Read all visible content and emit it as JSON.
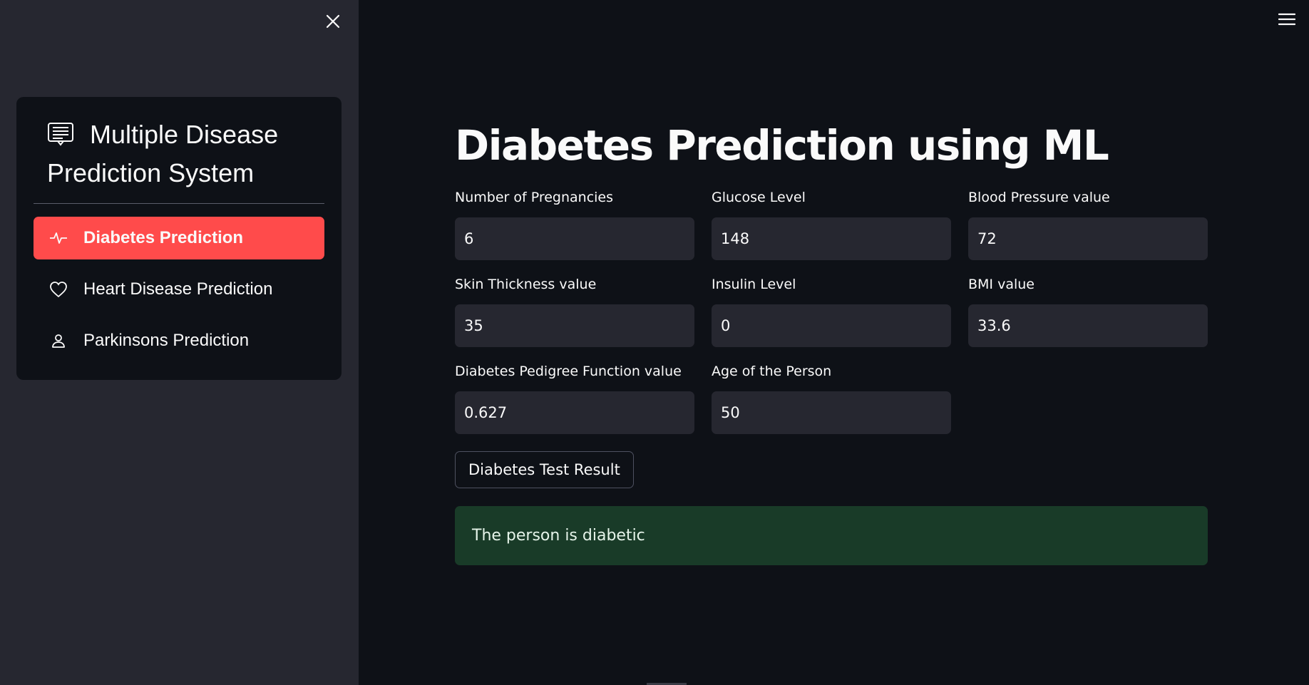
{
  "sidebar": {
    "close_icon": "close-icon",
    "menu": {
      "title": "Multiple Disease Prediction System",
      "title_icon": "document-icon",
      "items": [
        {
          "label": "Diabetes Prediction",
          "icon": "activity-icon",
          "active": true
        },
        {
          "label": "Heart Disease Prediction",
          "icon": "heart-icon",
          "active": false
        },
        {
          "label": "Parkinsons Prediction",
          "icon": "person-icon",
          "active": false
        }
      ]
    }
  },
  "header": {
    "menu_icon": "hamburger-icon"
  },
  "main": {
    "title": "Diabetes Prediction using ML",
    "fields": [
      {
        "label": "Number of Pregnancies",
        "value": "6"
      },
      {
        "label": "Glucose Level",
        "value": "148"
      },
      {
        "label": "Blood Pressure value",
        "value": "72"
      },
      {
        "label": "Skin Thickness value",
        "value": "35"
      },
      {
        "label": "Insulin Level",
        "value": "0"
      },
      {
        "label": "BMI value",
        "value": "33.6"
      },
      {
        "label": "Diabetes Pedigree Function value",
        "value": "0.627"
      },
      {
        "label": "Age of the Person",
        "value": "50"
      }
    ],
    "button_label": "Diabetes Test Result",
    "result_message": "The person is diabetic"
  },
  "colors": {
    "background": "#0e1117",
    "sidebar": "#262730",
    "accent": "#ff4b4b",
    "success_bg": "#193b28"
  }
}
